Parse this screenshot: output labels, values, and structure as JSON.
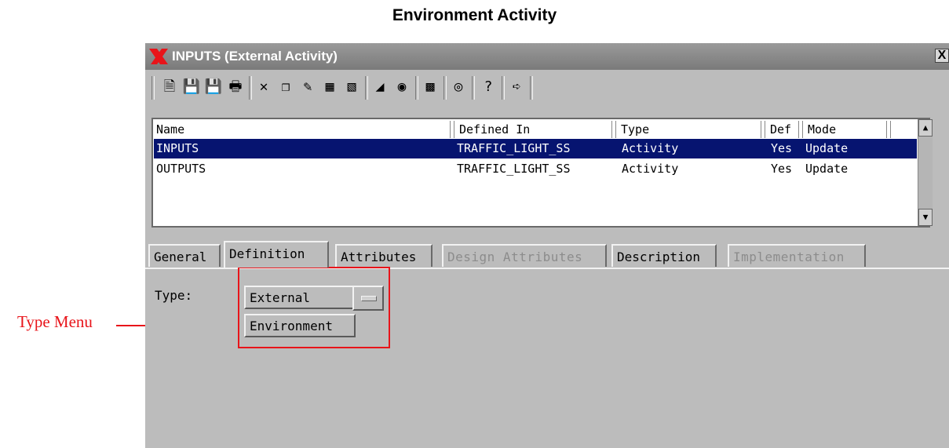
{
  "document": {
    "title": "Environment Activity",
    "callout": "Type Menu"
  },
  "window": {
    "title": "INPUTS (External Activity)",
    "close_glyph": "X"
  },
  "toolbar": {
    "icons": [
      "new-doc-icon",
      "save-icon",
      "save-all-icon",
      "print-icon",
      "delete-icon",
      "copy-icon",
      "rename-icon",
      "tree-icon",
      "tree-sync-icon",
      "search-icon",
      "find-icon",
      "browser-icon",
      "binoculars-icon",
      "help-icon",
      "exit-icon"
    ]
  },
  "list": {
    "columns": [
      "Name",
      "Defined In",
      "Type",
      "Def",
      "Mode"
    ],
    "rows": [
      {
        "name": "INPUTS",
        "defined_in": "TRAFFIC_LIGHT_SS",
        "type": "Activity",
        "def": "Yes",
        "mode": "Update",
        "selected": true
      },
      {
        "name": "OUTPUTS",
        "defined_in": "TRAFFIC_LIGHT_SS",
        "type": "Activity",
        "def": "Yes",
        "mode": "Update",
        "selected": false
      }
    ]
  },
  "tabs": [
    {
      "label": "General",
      "state": "normal"
    },
    {
      "label": "Definition",
      "state": "active"
    },
    {
      "label": "Attributes",
      "state": "normal"
    },
    {
      "label": "Design Attributes",
      "state": "disabled"
    },
    {
      "label": "Description",
      "state": "normal"
    },
    {
      "label": "Implementation",
      "state": "disabled"
    }
  ],
  "definition": {
    "type_label": "Type:",
    "type_selected": "External",
    "type_options": [
      "Environment"
    ]
  },
  "colors": {
    "selection": "#061470",
    "annotation": "#e8141a",
    "panel": "#bcbcbc"
  }
}
